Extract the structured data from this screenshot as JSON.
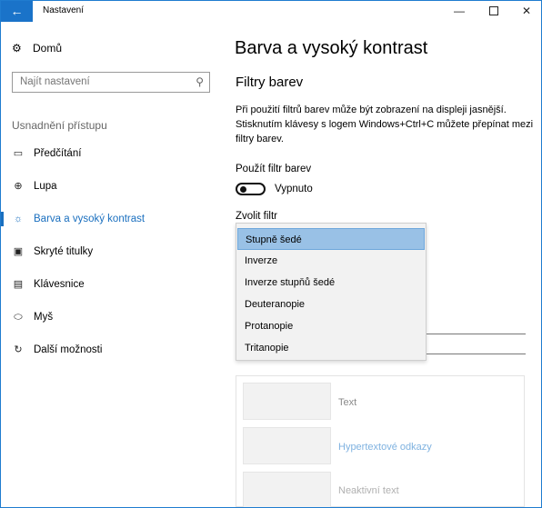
{
  "window": {
    "title": "Nastavení",
    "back_icon": "←",
    "minimize_icon": "—",
    "close_icon": "✕"
  },
  "nav": {
    "home": {
      "icon": "gear-icon",
      "label": "Domů"
    },
    "search": {
      "placeholder": "Najít nastavení",
      "icon": "search-icon"
    },
    "section_label": "Usnadnění přístupu",
    "items": [
      {
        "label": "Předčítání",
        "icon": "narrator-icon"
      },
      {
        "label": "Lupa",
        "icon": "magnifier-icon"
      },
      {
        "label": "Barva a vysoký kontrast",
        "icon": "brightness-icon",
        "active": true
      },
      {
        "label": "Skryté titulky",
        "icon": "closed-captions-icon"
      },
      {
        "label": "Klávesnice",
        "icon": "keyboard-icon"
      },
      {
        "label": "Myš",
        "icon": "mouse-icon"
      },
      {
        "label": "Další možnosti",
        "icon": "other-options-icon"
      }
    ]
  },
  "main": {
    "title": "Barva a vysoký kontrast",
    "section_title": "Filtry barev",
    "description": "Při použití filtrů barev může být zobrazení na displeji jasnější. Stisknutím klávesy s logem Windows+Ctrl+C můžete přepínat mezi filtry barev.",
    "filter_toggle_label": "Použít filtr barev",
    "filter_toggle_state": "Vypnuto",
    "filter_toggle_on": false,
    "choose_filter_label": "Zvolit filtr",
    "filter_options": [
      "Stupně šedé",
      "Inverze",
      "Inverze stupňů šedé",
      "Deuteranopie",
      "Protanopie",
      "Tritanopie"
    ],
    "selected_filter": "Stupně šedé",
    "preview": {
      "text_label": "Text",
      "hyperlink_label": "Hypertextové odkazy",
      "inactive_label": "Neaktivní text"
    }
  },
  "colors": {
    "accent": "#1a6fbf",
    "back_button": "#1a73c9",
    "selected_item": "#99c1e6",
    "hyperlink": "#7fb2e0",
    "inactive_text": "#b0b0b0",
    "preview_text": "#8a8a8a"
  }
}
